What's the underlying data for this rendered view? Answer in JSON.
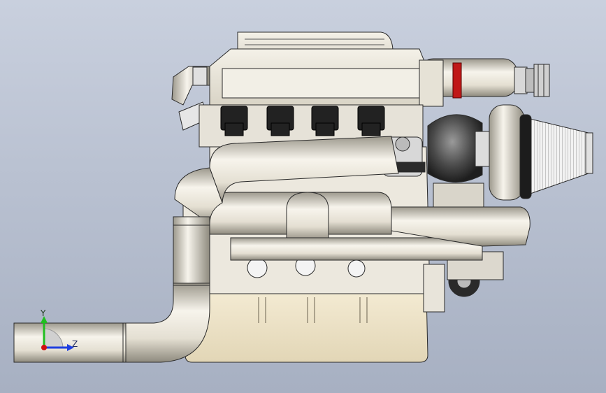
{
  "triad": {
    "y_label": "Y",
    "z_label": "Z",
    "colors": {
      "y": "#1fbf1f",
      "z": "#1f3fe0",
      "x": "#d01010"
    }
  },
  "scene": {
    "background": "#b9c1d1",
    "part_fill": "#eeeae0",
    "part_edge": "#2a2a2a",
    "accent_red": "#c01818"
  }
}
